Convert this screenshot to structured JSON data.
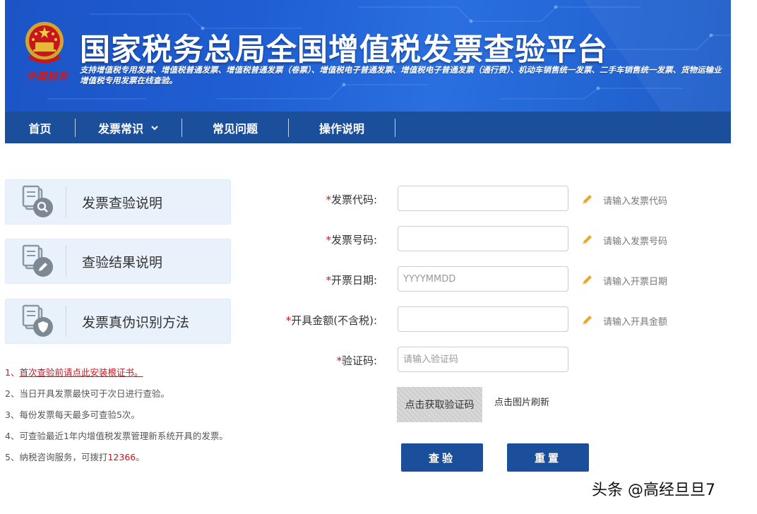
{
  "header": {
    "title": "国家税务总局全国增值税发票查验平台",
    "subtitle": "支持增值税专用发票、增值税普通发票、增值税普通发票（卷票）、增值税电子普通发票、增值税电子普通发票（通行费）、机动车销售统一发票、二手车销售统一发票、货物运输业增值税专用发票在线查验。",
    "seal_text": "中国税务",
    "brand_color": "#1c54c6"
  },
  "nav": {
    "items": [
      {
        "label": "首页"
      },
      {
        "label": "发票常识",
        "icon": "chevron-down-icon"
      },
      {
        "label": "常见问题"
      },
      {
        "label": "操作说明"
      }
    ],
    "color": "#1b4f9b"
  },
  "left_panel": {
    "cards": [
      {
        "label": "发票查验说明",
        "icon": "document-search-icon"
      },
      {
        "label": "查验结果说明",
        "icon": "document-edit-icon"
      },
      {
        "label": "发票真伪识别方法",
        "icon": "document-shield-icon"
      }
    ],
    "notes": {
      "n1_prefix": "1、",
      "n1_link": "首次查验前请点此安装根证书。",
      "n2": "2、当日开具发票最快可于次日进行查验。",
      "n3": "3、每份发票每天最多可查验5次。",
      "n4": "4、可查验最近1年内增值税发票管理新系统开具的发票。",
      "n5_prefix": "5、纳税咨询服务，可拨打",
      "n5_phone": "12366",
      "n5_suffix": "。"
    }
  },
  "form": {
    "code": {
      "label": "发票代码:",
      "value": "",
      "placeholder": "",
      "hint": "请输入发票代码"
    },
    "number": {
      "label": "发票号码:",
      "value": "",
      "placeholder": "",
      "hint": "请输入发票号码"
    },
    "date": {
      "label": "开票日期:",
      "value": "",
      "placeholder": "YYYYMMDD",
      "hint": "请输入开票日期"
    },
    "amount": {
      "label": "开具金额(不含税):",
      "value": "",
      "placeholder": "",
      "hint": "请输入开具金额"
    },
    "captcha": {
      "label": "验证码:",
      "value": "",
      "placeholder": "请输入验证码"
    },
    "captcha_image_text": "点击获取验证码",
    "refresh_tip": "点击图片刷新",
    "required_mark": "*",
    "submit_label": "查验",
    "reset_label": "重置"
  },
  "watermark": "头条 @高经旦旦7"
}
